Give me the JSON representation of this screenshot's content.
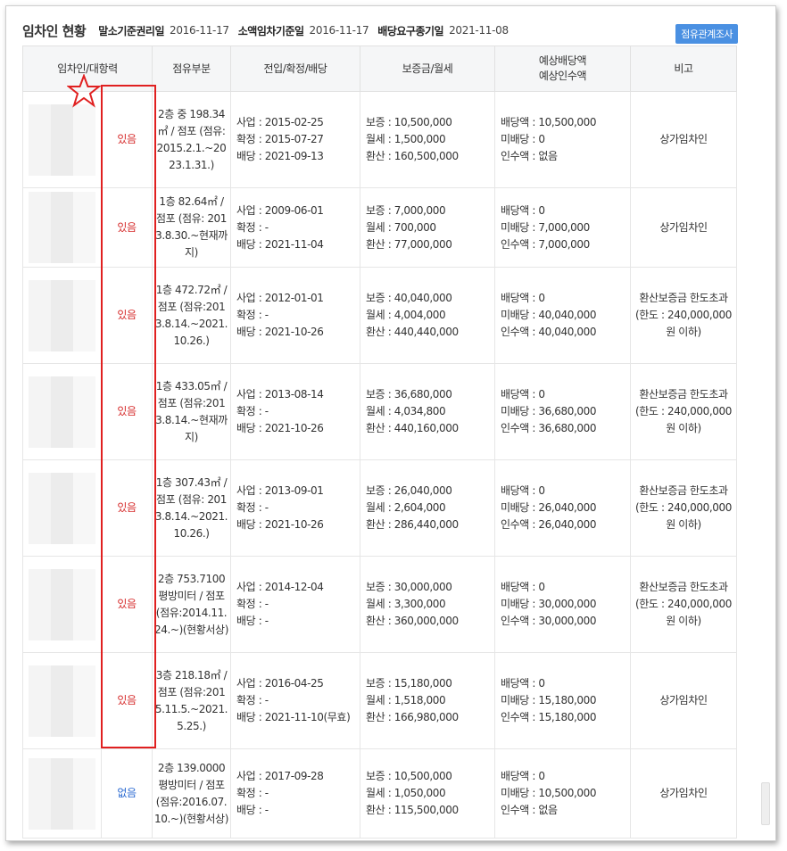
{
  "header": {
    "title": "임차인 현황",
    "items": [
      {
        "label": "말소기준권리일",
        "value": "2016-11-17"
      },
      {
        "label": "소액임차기준일",
        "value": "2016-11-17"
      },
      {
        "label": "배당요구종기일",
        "value": "2021-11-08"
      }
    ],
    "survey_button": "점유관계조사"
  },
  "columns": {
    "tenant": "임차인/대항력",
    "part": "점유부분",
    "dates": "전입/확정/배당",
    "deposit": "보증금/월세",
    "distribution_1": "예상배당액",
    "distribution_2": "예상인수액",
    "note": "비고"
  },
  "rows": [
    {
      "opposition": "있음",
      "part": "2층 중 198.34㎡ / 점포 (점유:2015.2.1.~2023.1.31.)",
      "dates": [
        "사업 : 2015-02-25",
        "확정 : 2015-07-27",
        "배당 : 2021-09-13"
      ],
      "deposit": [
        "보증 : 10,500,000",
        "월세 : 1,500,000",
        "환산 : 160,500,000"
      ],
      "distribution": [
        "배당액 : 10,500,000",
        "미배당 : 0",
        "인수액 : 없음"
      ],
      "note": "상가임차인"
    },
    {
      "opposition": "있음",
      "part": "1층 82.64㎡ / 점포 (점유: 2013.8.30.~현재까지)",
      "dates": [
        "사업 : 2009-06-01",
        "확정 : -",
        "배당 : 2021-11-04"
      ],
      "deposit": [
        "보증 : 7,000,000",
        "월세 : 700,000",
        "환산 : 77,000,000"
      ],
      "distribution": [
        "배당액 : 0",
        "미배당 : 7,000,000",
        "인수액 : 7,000,000"
      ],
      "note": "상가임차인"
    },
    {
      "opposition": "있음",
      "part": "1층 472.72㎡ / 점포 (점유:2013.8.14.~2021.10.26.)",
      "dates": [
        "사업 : 2012-01-01",
        "확정 : -",
        "배당 : 2021-10-26"
      ],
      "deposit": [
        "보증 : 40,040,000",
        "월세 : 4,004,000",
        "환산 : 440,440,000"
      ],
      "distribution": [
        "배당액 : 0",
        "미배당 : 40,040,000",
        "인수액 : 40,040,000"
      ],
      "note": "환산보증금 한도초과(한도 : 240,000,000원 이하)"
    },
    {
      "opposition": "있음",
      "part": "1층 433.05㎡ / 점포 (점유:2013.8.14.~현재까지)",
      "dates": [
        "사업 : 2013-08-14",
        "확정 : -",
        "배당 : 2021-10-26"
      ],
      "deposit": [
        "보증 : 36,680,000",
        "월세 : 4,034,800",
        "환산 : 440,160,000"
      ],
      "distribution": [
        "배당액 : 0",
        "미배당 : 36,680,000",
        "인수액 : 36,680,000"
      ],
      "note": "환산보증금 한도초과(한도 : 240,000,000원 이하)"
    },
    {
      "opposition": "있음",
      "part": "1층 307.43㎡ / 점포 (점유: 2013.8.14.~2021.10.26.)",
      "dates": [
        "사업 : 2013-09-01",
        "확정 : -",
        "배당 : 2021-10-26"
      ],
      "deposit": [
        "보증 : 26,040,000",
        "월세 : 2,604,000",
        "환산 : 286,440,000"
      ],
      "distribution": [
        "배당액 : 0",
        "미배당 : 26,040,000",
        "인수액 : 26,040,000"
      ],
      "note": "환산보증금 한도초과(한도 : 240,000,000원 이하)"
    },
    {
      "opposition": "있음",
      "part": "2층 753.7100평방미터 / 점포 (점유:2014.11.24.~)(현황서상)",
      "dates": [
        "사업 : 2014-12-04",
        "확정 : -",
        "배당 : -"
      ],
      "deposit": [
        "보증 : 30,000,000",
        "월세 : 3,300,000",
        "환산 : 360,000,000"
      ],
      "distribution": [
        "배당액 : 0",
        "미배당 : 30,000,000",
        "인수액 : 30,000,000"
      ],
      "note": "환산보증금 한도초과(한도 : 240,000,000원 이하)"
    },
    {
      "opposition": "있음",
      "part": "3층 218.18㎡ / 점포 (점유:2015.11.5.~2021.5.25.)",
      "dates": [
        "사업 : 2016-04-25",
        "확정 : -",
        "배당 : 2021-11-10(무효)"
      ],
      "deposit": [
        "보증 : 15,180,000",
        "월세 : 1,518,000",
        "환산 : 166,980,000"
      ],
      "distribution": [
        "배당액 : 0",
        "미배당 : 15,180,000",
        "인수액 : 15,180,000"
      ],
      "note": "상가임차인"
    },
    {
      "opposition": "없음",
      "part": "2층 139.0000평방미터 / 점포 (점유:2016.07.10.~)(현황서상)",
      "dates": [
        "사업 : 2017-09-28",
        "확정 : -",
        "배당 : -"
      ],
      "deposit": [
        "보증 : 10,500,000",
        "월세 : 1,050,000",
        "환산 : 115,500,000"
      ],
      "distribution": [
        "배당액 : 0",
        "미배당 : 10,500,000",
        "인수액 : 없음"
      ],
      "note": "상가임차인"
    }
  ]
}
